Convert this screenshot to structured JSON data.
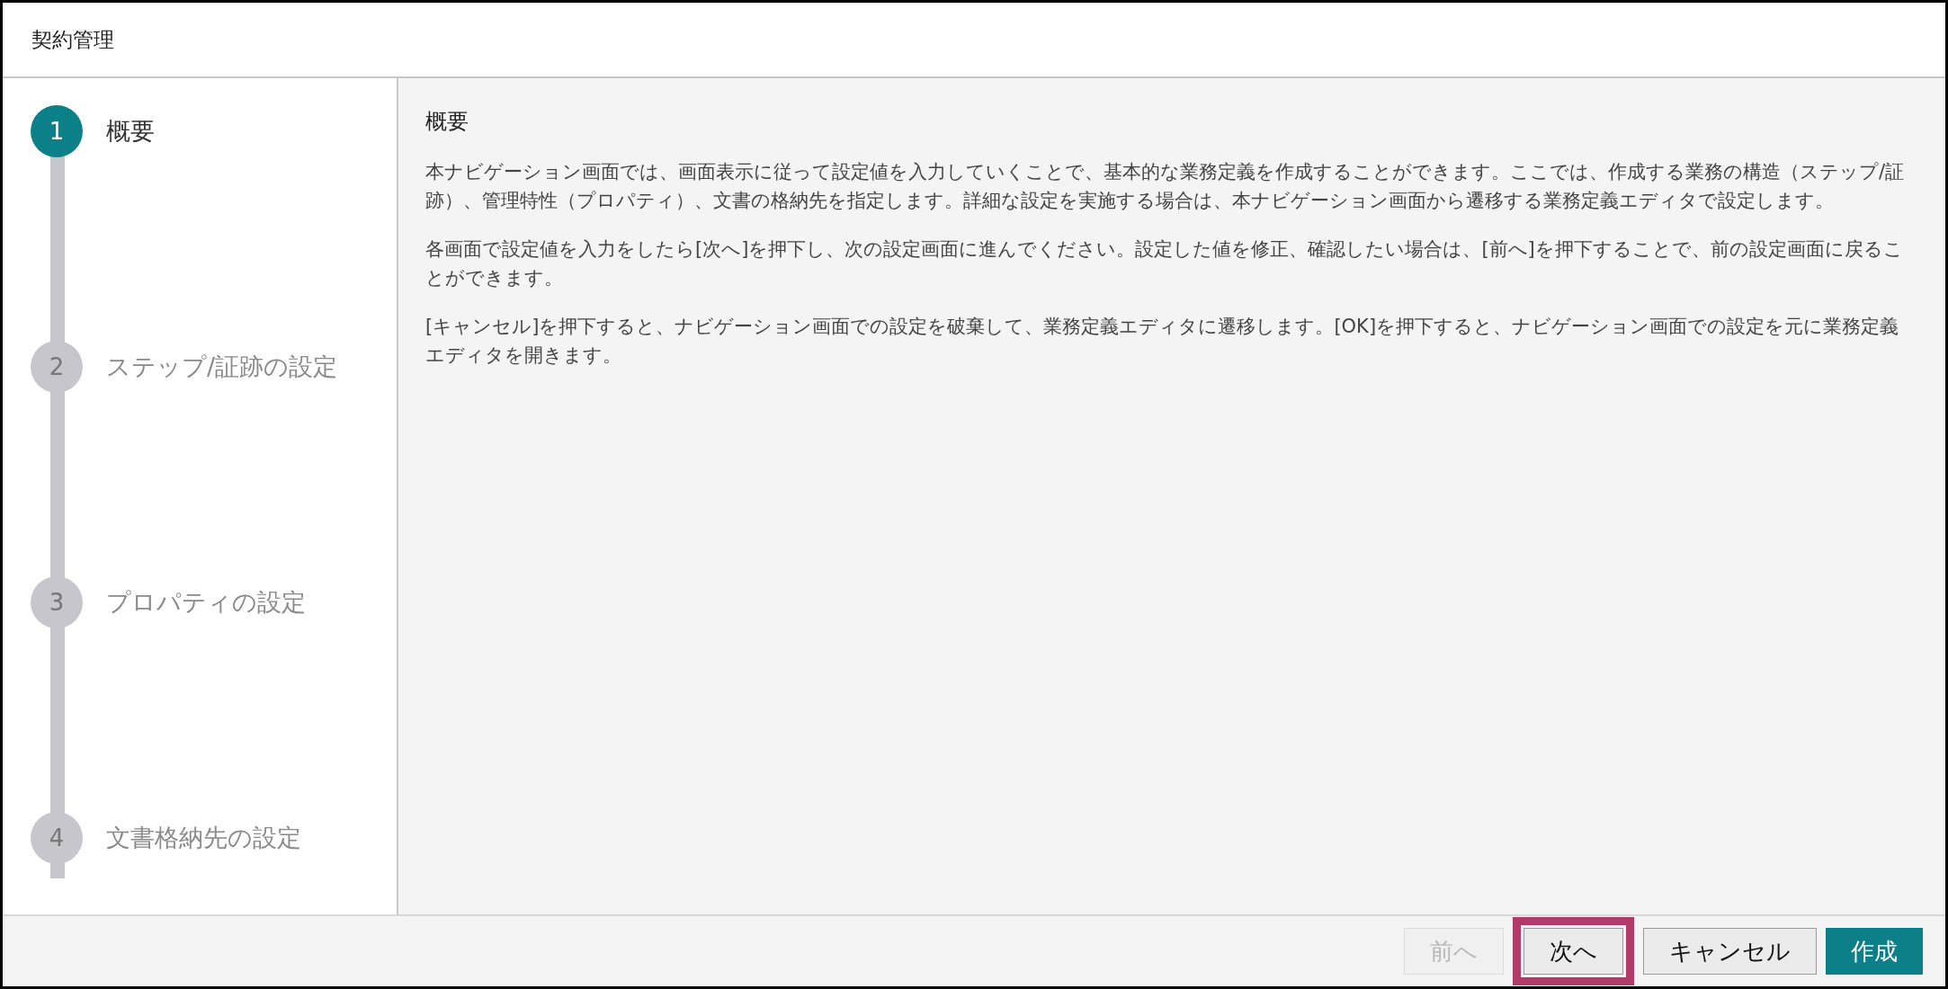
{
  "window": {
    "title": "契約管理"
  },
  "steps": [
    {
      "number": "1",
      "label": "概要",
      "selected": true
    },
    {
      "number": "2",
      "label": "ステップ/証跡の設定",
      "selected": false
    },
    {
      "number": "3",
      "label": "プロパティの設定",
      "selected": false
    },
    {
      "number": "4",
      "label": "文書格納先の設定",
      "selected": false
    }
  ],
  "content": {
    "heading": "概要",
    "paragraphs": [
      "本ナビゲーション画面では、画面表示に従って設定値を入力していくことで、基本的な業務定義を作成することができます。ここでは、作成する業務の構造（ステップ/証跡）、管理特性（プロパティ）、文書の格納先を指定します。詳細な設定を実施する場合は、本ナビゲーション画面から遷移する業務定義エディタで設定します。",
      "各画面で設定値を入力をしたら[次へ]を押下し、次の設定画面に進んでください。設定した値を修正、確認したい場合は、[前へ]を押下することで、前の設定画面に戻ることができます。",
      "[キャンセル]を押下すると、ナビゲーション画面での設定を破棄して、業務定義エディタに遷移します。[OK]を押下すると、ナビゲーション画面での設定を元に業務定義エディタを開きます。"
    ]
  },
  "buttons": [
    {
      "label": "前へ",
      "kind": "secondary",
      "disabled": true,
      "highlighted": false
    },
    {
      "label": "次へ",
      "kind": "secondary",
      "disabled": false,
      "highlighted": true
    },
    {
      "label": "キャンセル",
      "kind": "secondary",
      "disabled": false,
      "highlighted": false
    },
    {
      "label": "作成",
      "kind": "primary",
      "disabled": false,
      "highlighted": false
    }
  ]
}
